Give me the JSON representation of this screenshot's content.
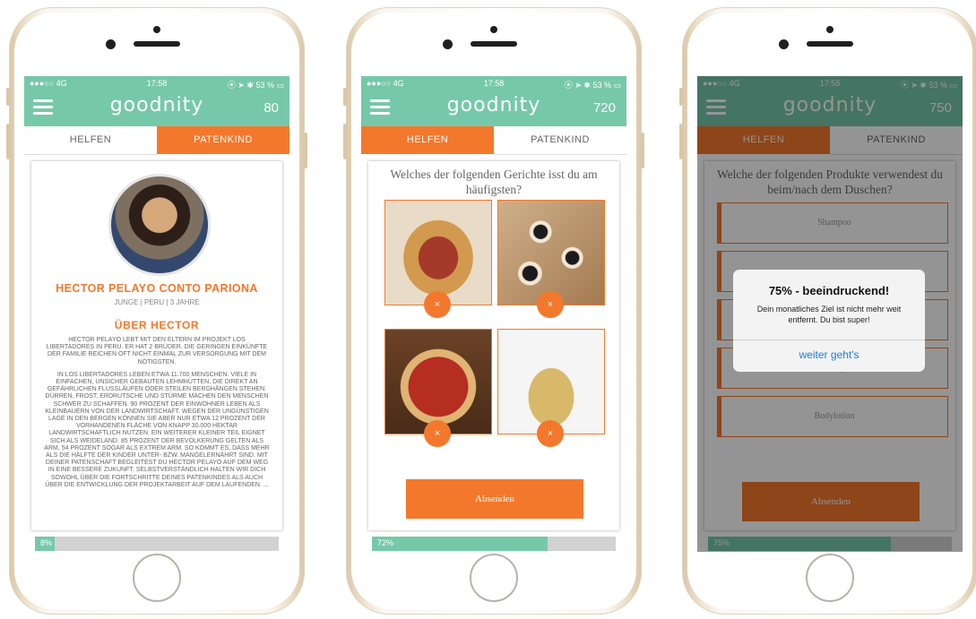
{
  "colors": {
    "teal": "#76c8ab",
    "orange": "#f4782c",
    "progress_track": "#d2d2d2",
    "alert_button": "#1a7fe6"
  },
  "phones": [
    {
      "status": {
        "signal": "●●●○○ 4G",
        "time": "17:58",
        "right": "⦿ ➤ ✱ 53 % ▭"
      },
      "app_name": "goodnity",
      "score": "80",
      "tabs": {
        "left": "HELFEN",
        "right": "PATENKIND",
        "active": "right"
      },
      "profile": {
        "avatar_icon": "child-portrait",
        "name": "HECTOR PELAYO CONTO PARIONA",
        "subtitle": "JUNGE | PERU | 3 JAHRE",
        "section_title": "ÜBER HECTOR",
        "para1": "HECTOR PELAYO LEBT MIT DEN ELTERN IM PROJEKT LOS LIBERTADORES IN PERU. ER HAT 2 BRÜDER. DIE GERINGEN EINKÜNFTE DER FAMILIE REICHEN OFT NICHT EINMAL ZUR VERSORGUNG MIT DEM NÖTIGSTEN.",
        "para2": "IN LOS LIBERTADORES LEBEN ETWA 11.700 MENSCHEN. VIELE IN EINFACHEN, UNSICHER GEBAUTEN LEHMHÜTTEN, DIE DIREKT AN GEFÄHRLICHEN FLUSSLÄUFEN ODER STEILEN BERGHÄNGEN STEHEN. DÜRREN, FROST, ERDRUTSCHE UND STÜRME MACHEN DEN MENSCHEN SCHWER ZU SCHAFFEN. 90 PROZENT DER EINWOHNER LEBEN ALS KLEINBAUERN VON DER LANDWIRTSCHAFT. WEGEN DER UNGÜNSTIGEN LAGE IN DEN BERGEN KÖNNEN SIE ABER NUR ETWA 12 PROZENT DER VORHANDENEN FLÄCHE VON KNAPP 30.000 HEKTAR LANDWIRTSCHAFTLICH NUTZEN. EIN WEITERER KLEINER TEIL EIGNET SICH ALS WEIDELAND. 85 PROZENT DER BEVÖLKERUNG GELTEN ALS ARM, 54 PROZENT SOGAR ALS EXTREM ARM. SO KOMMT ES, DASS MEHR ALS DIE HÄLFTE DER KINDER UNTER- BZW. MANGELERNÄHRT SIND. MIT DEINER PATENSCHAFT BEGLEITEST DU HECTOR PELAYO AUF DEM WEG IN EINE BESSERE ZUKUNFT. SELBSTVERSTÄNDLICH HALTEN WIR DICH SOWOHL ÜBER DIE FORTSCHRITTE DEINES PATENKINDES ALS AUCH ÜBER DIE ENTWICKLUNG DER PROJEKTARBEIT AUF DEM LAUFENDEN. ..."
      },
      "progress": {
        "value": 0.08,
        "label": "8%"
      }
    },
    {
      "status": {
        "signal": "●●●○○ 4G",
        "time": "17:58",
        "right": "⦿ ➤ ✱ 53 % ▭"
      },
      "app_name": "goodnity",
      "score": "720",
      "tabs": {
        "left": "HELFEN",
        "right": "PATENKIND",
        "active": "left"
      },
      "question": "Welches der folgenden Gerichte isst du am häufigsten?",
      "options": [
        {
          "name": "burger",
          "dismiss": "×"
        },
        {
          "name": "sushi",
          "dismiss": "×"
        },
        {
          "name": "pizza",
          "dismiss": "×"
        },
        {
          "name": "noodles",
          "dismiss": "×"
        }
      ],
      "submit": "Absenden",
      "progress": {
        "value": 0.72,
        "label": "72%"
      }
    },
    {
      "status": {
        "signal": "●●●○○ 4G",
        "time": "17:58",
        "right": "⦿ ➤ ✱ 53 % ▭"
      },
      "app_name": "goodnity",
      "score": "750",
      "tabs": {
        "left": "HELFEN",
        "right": "PATENKIND",
        "active": "left"
      },
      "question": "Welche der folgenden Produkte verwendest du beim/nach dem Duschen?",
      "options": [
        "Shampoo",
        "",
        "",
        "Duschgel",
        "Bodylotion"
      ],
      "submit": "Absenden",
      "progress": {
        "value": 0.75,
        "label": "75%"
      },
      "alert": {
        "title": "75% - beeindruckend!",
        "message": "Dein monatliches Ziel ist nicht mehr weit entfernt. Du bist super!",
        "button": "weiter geht's"
      }
    }
  ]
}
